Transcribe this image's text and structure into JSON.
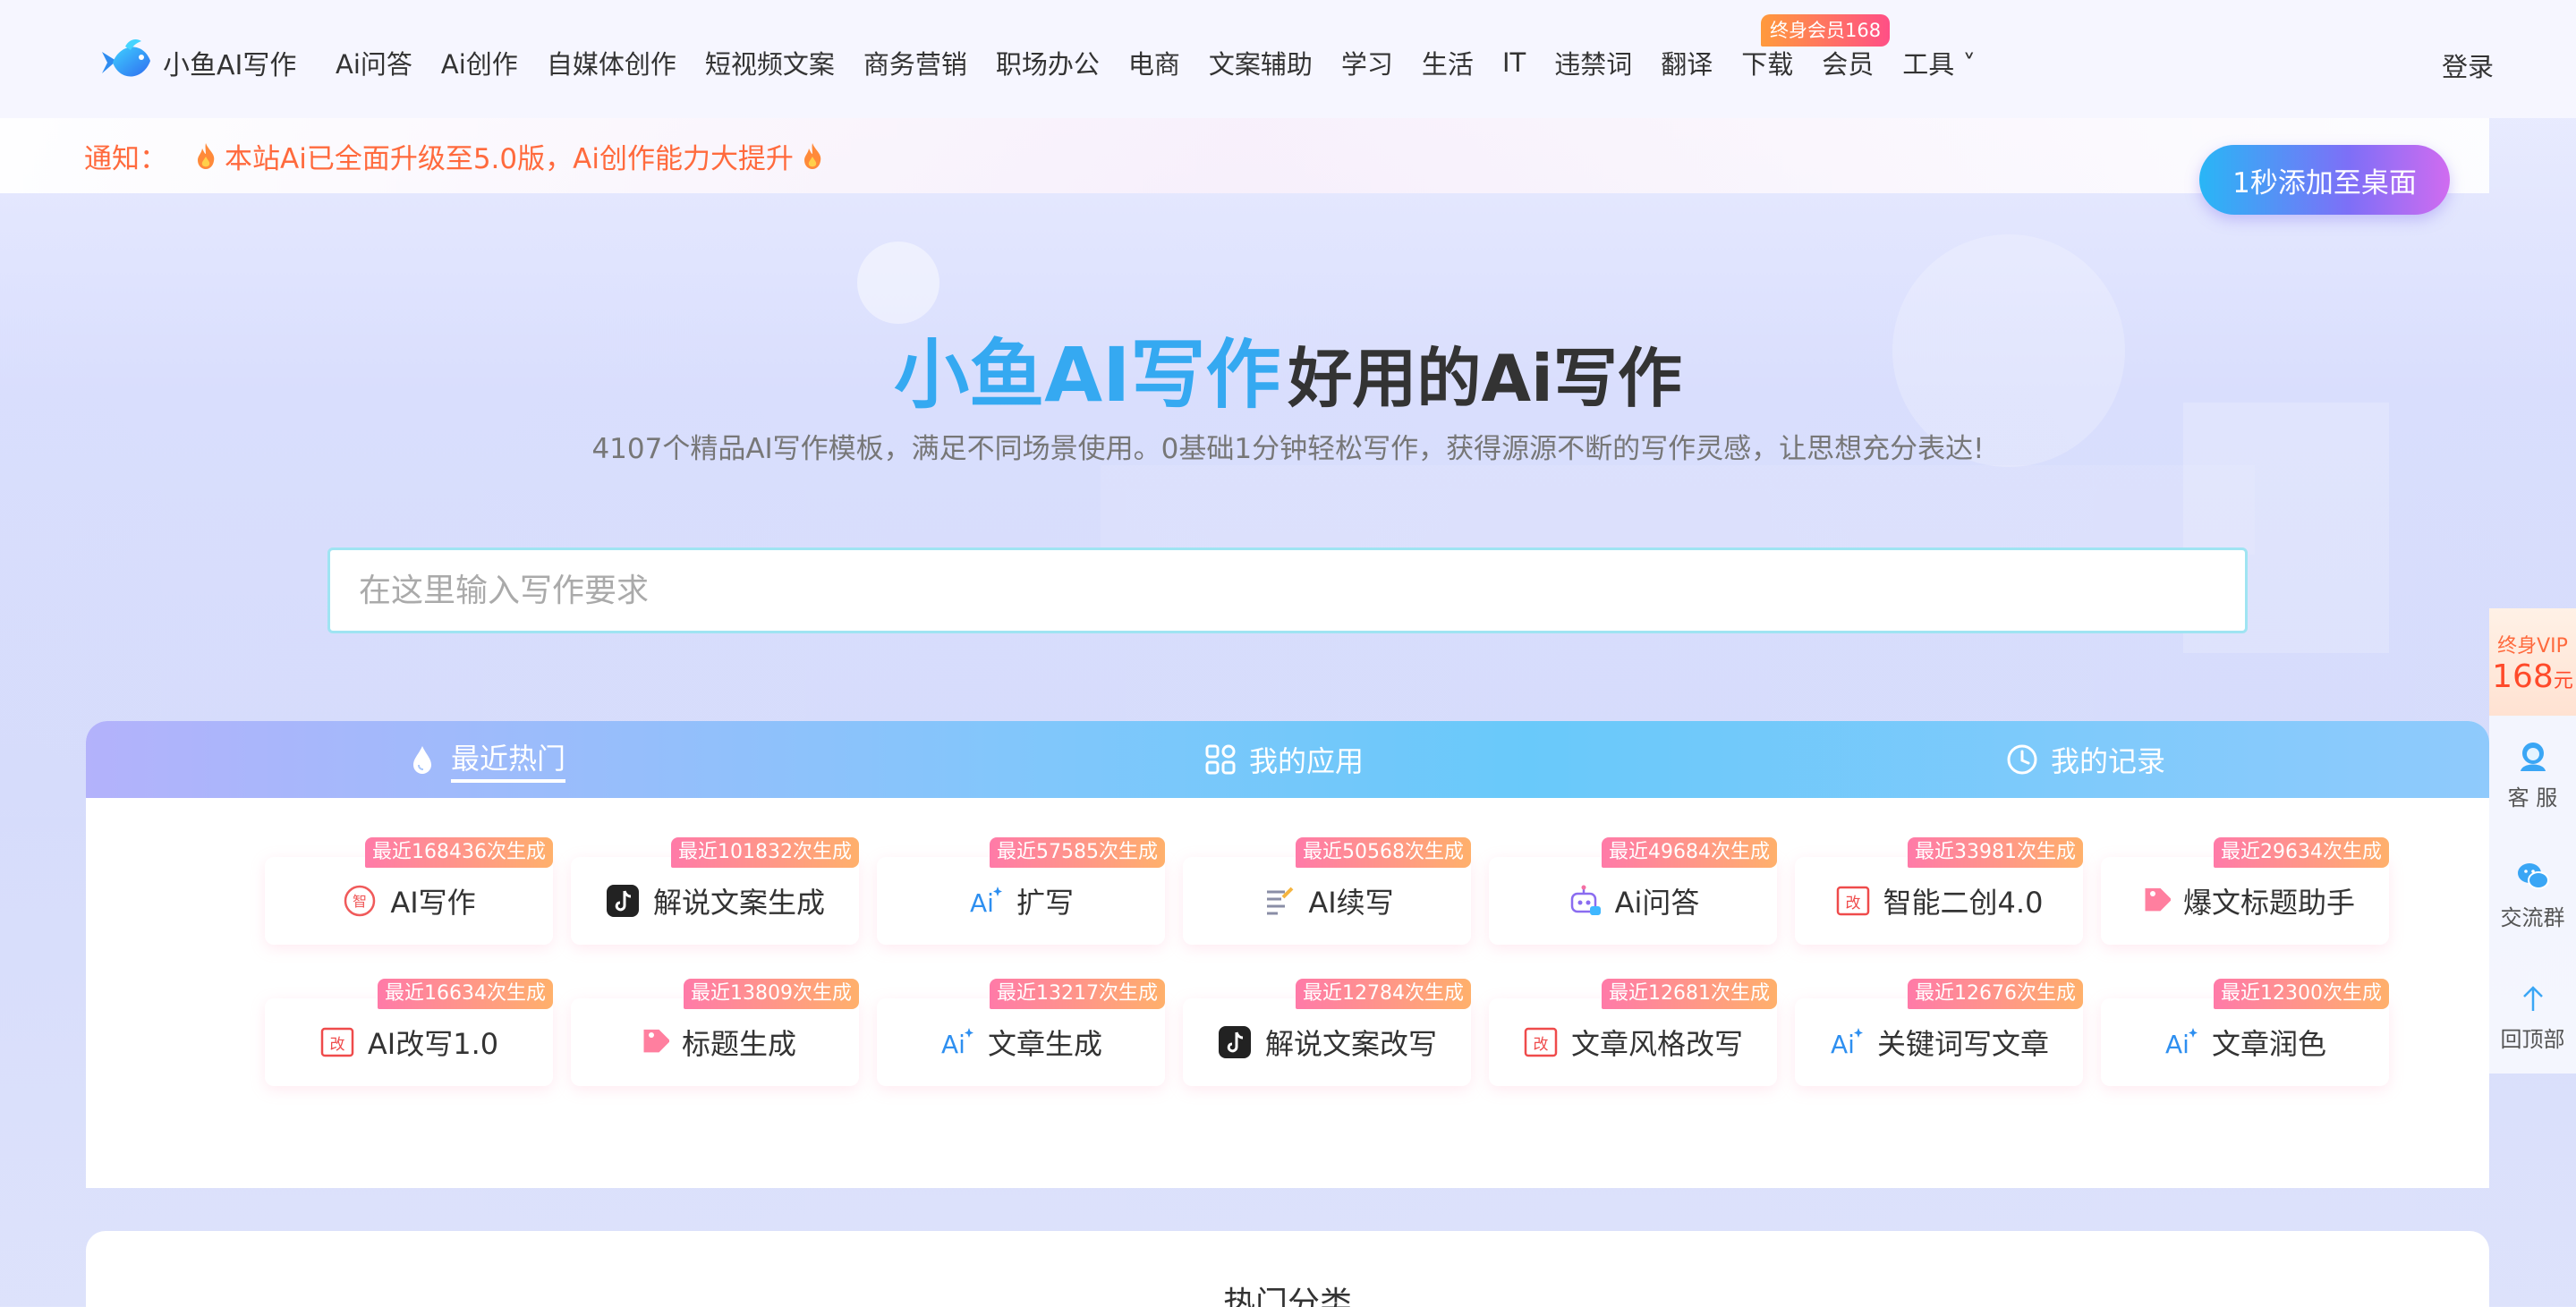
{
  "header": {
    "logo_text": "小鱼AI写作",
    "nav": [
      "Ai问答",
      "Ai创作",
      "自媒体创作",
      "短视频文案",
      "商务营销",
      "职场办公",
      "电商",
      "文案辅助",
      "学习",
      "生活",
      "IT",
      "违禁词",
      "翻译",
      "下载",
      "会员",
      "工具 ˅"
    ],
    "vip_tag": "终身会员168",
    "login": "登录"
  },
  "notice": {
    "label": "通知：",
    "text": "本站Ai已全面升级至5.0版，Ai创作能力大提升"
  },
  "add_desktop": "1秒添加至桌面",
  "hero": {
    "brand": "小鱼AI写作",
    "rest": "好用的Ai写作",
    "subtitle": "4107个精品AI写作模板，满足不同场景使用。0基础1分钟轻松写作，获得源源不断的写作灵感，让思想充分表达!"
  },
  "search": {
    "placeholder": "在这里输入写作要求"
  },
  "tabs": [
    {
      "label": "最近热门"
    },
    {
      "label": "我的应用"
    },
    {
      "label": "我的记录"
    }
  ],
  "cards": [
    {
      "label": "AI写作",
      "badge": "最近168436次生成",
      "icon": "write-icon"
    },
    {
      "label": "解说文案生成",
      "badge": "最近101832次生成",
      "icon": "tiktok-icon"
    },
    {
      "label": "扩写",
      "badge": "最近57585次生成",
      "icon": "ai-icon"
    },
    {
      "label": "AI续写",
      "badge": "最近50568次生成",
      "icon": "doc-icon"
    },
    {
      "label": "Ai问答",
      "badge": "最近49684次生成",
      "icon": "robot-icon"
    },
    {
      "label": "智能二创4.0",
      "badge": "最近33981次生成",
      "icon": "rewrite-icon"
    },
    {
      "label": "爆文标题助手",
      "badge": "最近29634次生成",
      "icon": "tag-icon"
    },
    {
      "label": "AI改写1.0",
      "badge": "最近16634次生成",
      "icon": "rewrite-icon"
    },
    {
      "label": "标题生成",
      "badge": "最近13809次生成",
      "icon": "tag-icon"
    },
    {
      "label": "文章生成",
      "badge": "最近13217次生成",
      "icon": "ai-icon"
    },
    {
      "label": "解说文案改写",
      "badge": "最近12784次生成",
      "icon": "tiktok-icon"
    },
    {
      "label": "文章风格改写",
      "badge": "最近12681次生成",
      "icon": "rewrite-icon"
    },
    {
      "label": "关键词写文章",
      "badge": "最近12676次生成",
      "icon": "ai-icon"
    },
    {
      "label": "文章润色",
      "badge": "最近12300次生成",
      "icon": "ai-icon"
    }
  ],
  "bottom": {
    "title": "热门分类"
  },
  "sidebar": {
    "vip_line1": "终身VIP",
    "vip_price": "168",
    "vip_unit": "元",
    "service": "客 服",
    "group": "交流群",
    "top": "回顶部"
  },
  "colors": {
    "accent_blue": "#35a9f1",
    "notice_orange": "#ff6a3d",
    "badge_pink": "#ff7aa8"
  }
}
